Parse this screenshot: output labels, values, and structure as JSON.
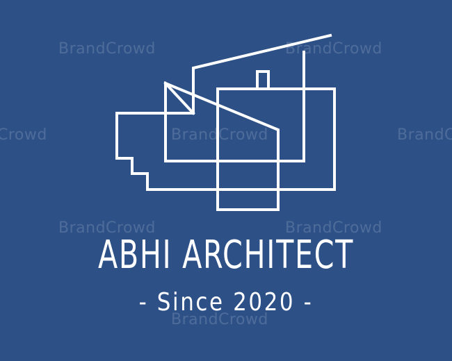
{
  "logo": {
    "name": "ABHI ARCHITECT",
    "tagline": "- Since 2020 -",
    "icon": "house-outline-icon"
  },
  "watermark": {
    "text": "BrandCrowd",
    "partial": "Crowd"
  },
  "colors": {
    "background": "#2d5087",
    "foreground": "#ffffff"
  }
}
